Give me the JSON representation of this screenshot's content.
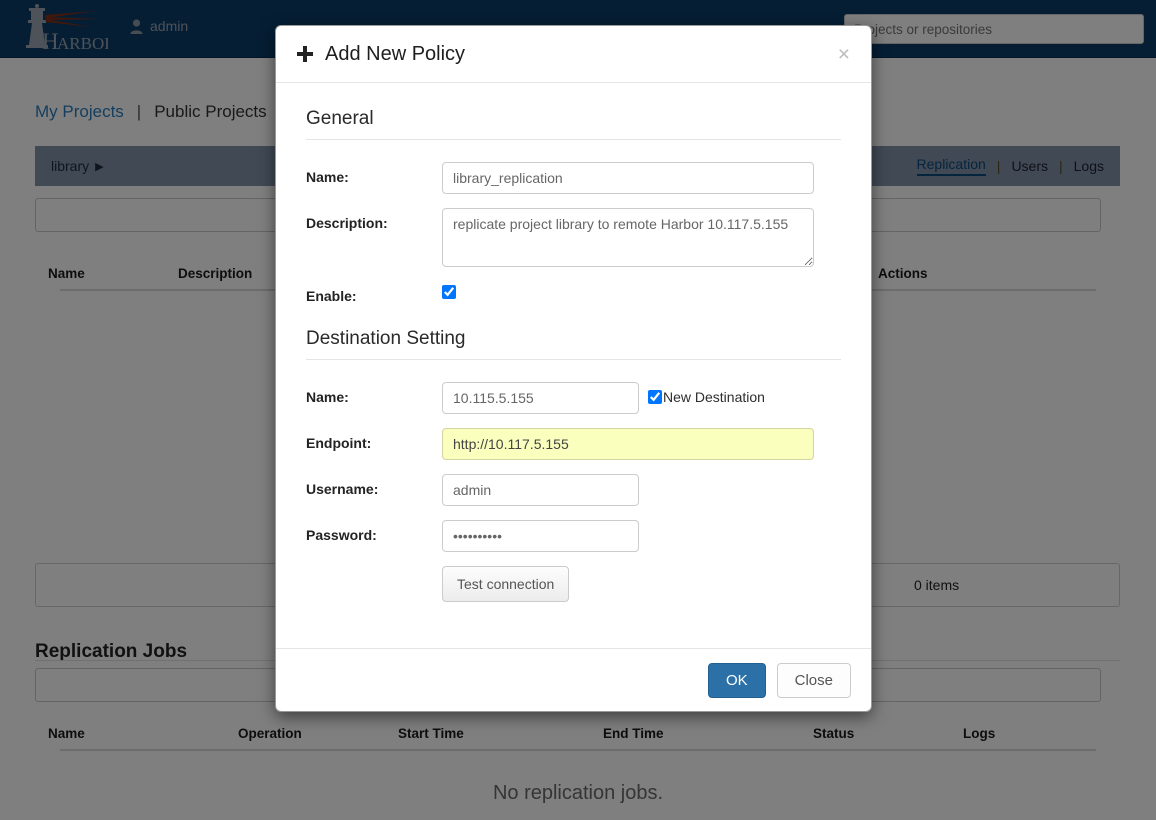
{
  "navbar": {
    "brand_name": "HARBOR",
    "user": "admin",
    "user_icon": "person-icon",
    "search_placeholder": "Projects or repositories",
    "search_value": ""
  },
  "page": {
    "project_tabs": {
      "my_projects": "My Projects",
      "separator": "|",
      "public_projects": "Public Projects"
    },
    "breadcrumb": "library",
    "breadcrumb_caret": "▶",
    "subnav": {
      "active": "Replication",
      "sep1": "|",
      "users": "Users",
      "sep2": "|",
      "logs": "Logs"
    },
    "filter_value": "",
    "policies_table": {
      "columns": [
        "Name",
        "Description",
        "Actions"
      ]
    },
    "policies_pager": {
      "items": "0 items"
    },
    "jobs_section_title": "Replication Jobs",
    "jobs_filter_value": "",
    "jobs_table": {
      "columns": [
        "Name",
        "Operation",
        "Start Time",
        "End Time",
        "Status",
        "Logs"
      ]
    },
    "jobs_empty": "No replication jobs."
  },
  "modal": {
    "title": "Add New Policy",
    "title_icon": "plus-icon",
    "close_icon": "×",
    "general": {
      "heading": "General",
      "name_label": "Name:",
      "name_value": "library_replication",
      "name_placeholder": "",
      "description_label": "Description:",
      "description_value": "replicate project library to remote Harbor 10.117.5.155",
      "description_placeholder": "",
      "enable_label": "Enable:",
      "enable_checked": true
    },
    "destination": {
      "heading": "Destination Setting",
      "name_label": "Name:",
      "name_value": "10.115.5.155",
      "new_destination_label": "New Destination",
      "new_destination_checked": true,
      "endpoint_label": "Endpoint:",
      "endpoint_value": "http://10.117.5.155",
      "endpoint_autofilled": true,
      "username_label": "Username:",
      "username_value": "admin",
      "password_label": "Password:",
      "password_value": "••••••••••",
      "test_connection_label": "Test connection"
    },
    "footer": {
      "ok_label": "OK",
      "close_label": "Close"
    }
  },
  "colors": {
    "navbar_bg": "#0a3c68",
    "accent_blue": "#2b7dbc",
    "primary_button": "#2b71a8",
    "subbar_bg": "#8092a8",
    "autofill_yellow": "#faffbd"
  }
}
